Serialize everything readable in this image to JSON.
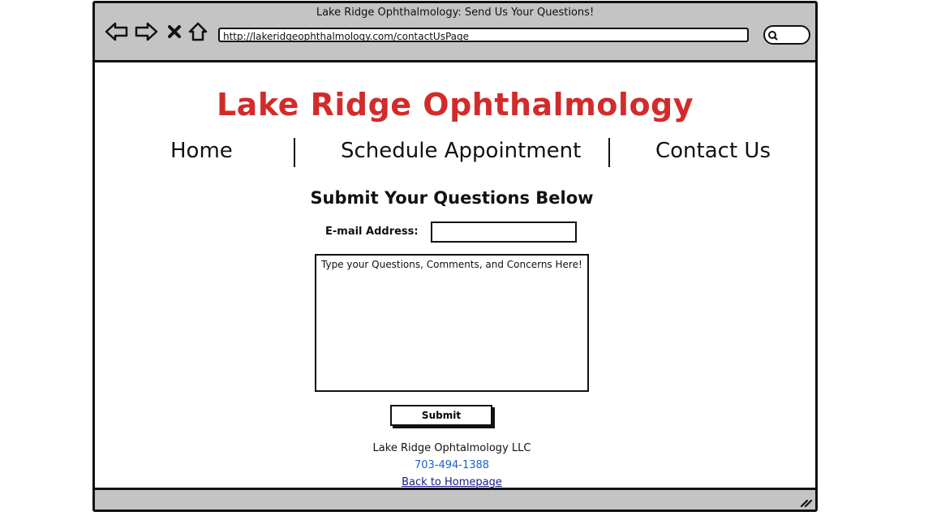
{
  "browser": {
    "window_title": "Lake Ridge Ophthalmology: Send Us Your Questions!",
    "url": "http://lakeridgeophthalmology.com/contactUsPage"
  },
  "site": {
    "title": "Lake Ridge Ophthalmology",
    "title_color": "#d22b2b"
  },
  "nav": {
    "items": [
      {
        "label": "Home"
      },
      {
        "label": "Schedule Appointment"
      },
      {
        "label": "Contact Us"
      }
    ]
  },
  "form": {
    "heading": "Submit Your Questions Below",
    "email_label": "E-mail Address:",
    "email_value": "",
    "message_placeholder": "Type your Questions, Comments, and Concerns Here!",
    "submit_label": "Submit"
  },
  "footer": {
    "company": "Lake Ridge Ophtalmology LLC",
    "phone": "703-494-1388",
    "back_link": "Back to Homepage"
  }
}
